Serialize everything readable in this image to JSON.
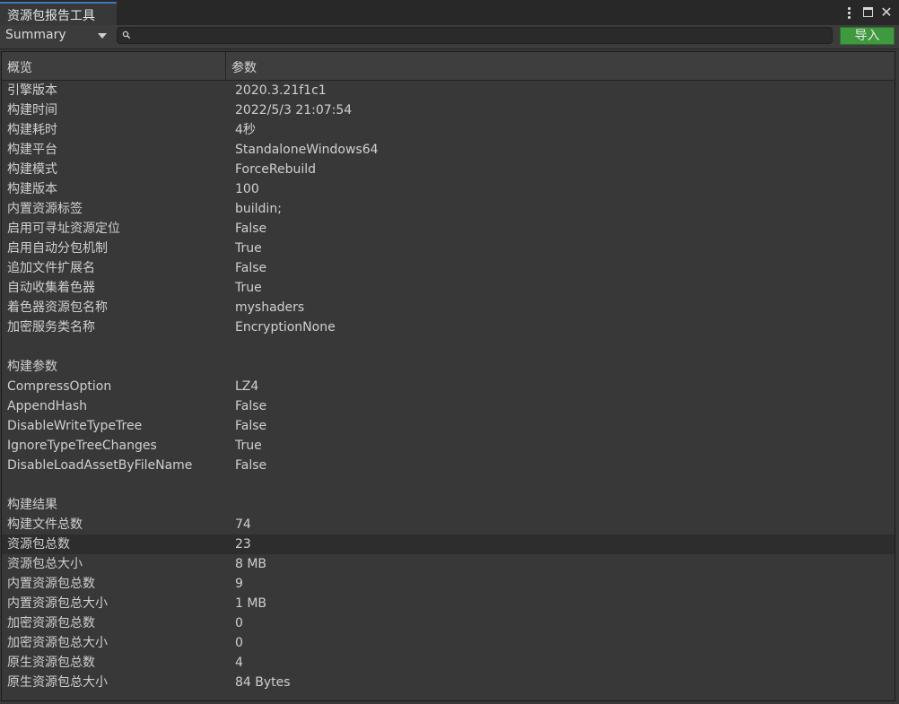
{
  "window": {
    "tab_title": "资源包报告工具",
    "close_glyph": "✕"
  },
  "toolbar": {
    "view_selected": "Summary",
    "search_value": "",
    "search_placeholder": "",
    "import_label": "导入",
    "import_color": "#3f9a3f"
  },
  "table": {
    "headers": {
      "key": "概览",
      "value": "参数"
    },
    "rows": [
      {
        "key": "引擎版本",
        "value": "2020.3.21f1c1"
      },
      {
        "key": "构建时间",
        "value": "2022/5/3 21:07:54"
      },
      {
        "key": "构建耗时",
        "value": "4秒"
      },
      {
        "key": "构建平台",
        "value": "StandaloneWindows64"
      },
      {
        "key": "构建模式",
        "value": "ForceRebuild"
      },
      {
        "key": "构建版本",
        "value": "100"
      },
      {
        "key": "内置资源标签",
        "value": "buildin;"
      },
      {
        "key": "启用可寻址资源定位",
        "value": "False"
      },
      {
        "key": "启用自动分包机制",
        "value": "True"
      },
      {
        "key": "追加文件扩展名",
        "value": "False"
      },
      {
        "key": "自动收集着色器",
        "value": "True"
      },
      {
        "key": "着色器资源包名称",
        "value": "myshaders"
      },
      {
        "key": "加密服务类名称",
        "value": "EncryptionNone"
      },
      {
        "key": "",
        "value": ""
      },
      {
        "key": "构建参数",
        "value": ""
      },
      {
        "key": "CompressOption",
        "value": "LZ4"
      },
      {
        "key": "AppendHash",
        "value": "False"
      },
      {
        "key": "DisableWriteTypeTree",
        "value": "False"
      },
      {
        "key": "IgnoreTypeTreeChanges",
        "value": "True"
      },
      {
        "key": "DisableLoadAssetByFileName",
        "value": "False"
      },
      {
        "key": "",
        "value": ""
      },
      {
        "key": "构建结果",
        "value": ""
      },
      {
        "key": "构建文件总数",
        "value": "74"
      },
      {
        "key": "资源包总数",
        "value": "23",
        "selected": true
      },
      {
        "key": "资源包总大小",
        "value": "8 MB"
      },
      {
        "key": "内置资源包总数",
        "value": "9"
      },
      {
        "key": "内置资源包总大小",
        "value": "1 MB"
      },
      {
        "key": "加密资源包总数",
        "value": "0"
      },
      {
        "key": "加密资源包总大小",
        "value": "0"
      },
      {
        "key": "原生资源包总数",
        "value": "4"
      },
      {
        "key": "原生资源包总大小",
        "value": "84 Bytes"
      }
    ]
  }
}
